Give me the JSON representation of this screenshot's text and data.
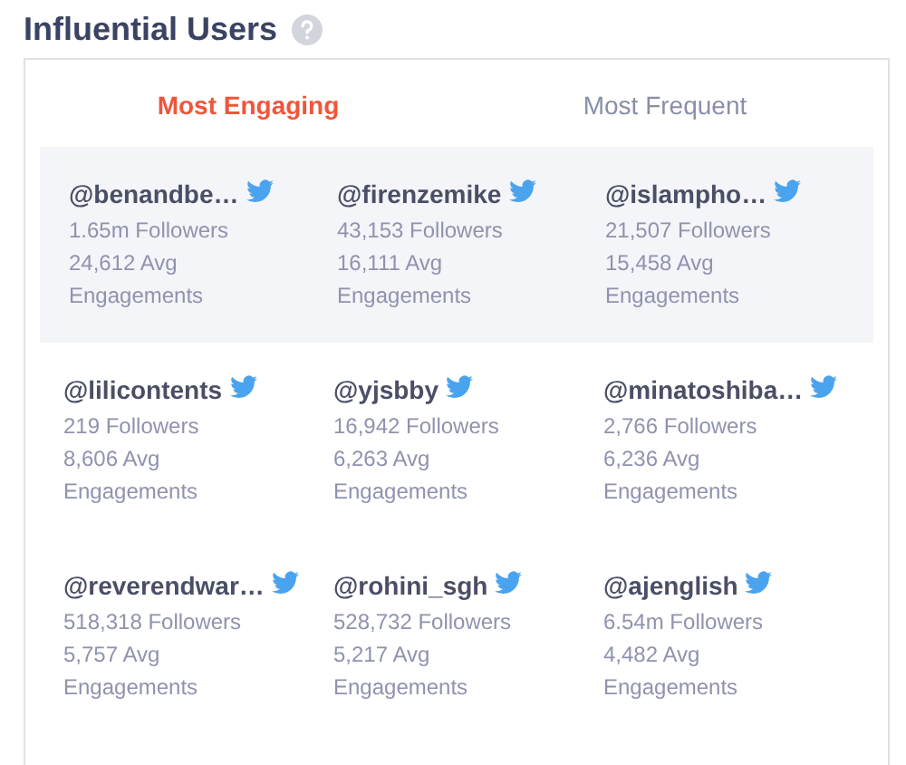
{
  "title": "Influential Users",
  "tabs": [
    {
      "label": "Most Engaging",
      "selected": true
    },
    {
      "label": "Most Frequent",
      "selected": false
    }
  ],
  "rows": [
    {
      "selected": true,
      "users": [
        {
          "handle": "@benandbe…",
          "followers": "1.65m Followers",
          "avg": "24,612 Avg",
          "engagements": "Engagements"
        },
        {
          "handle": "@firenzemike",
          "followers": "43,153 Followers",
          "avg": "16,111 Avg",
          "engagements": "Engagements"
        },
        {
          "handle": "@islampho…",
          "followers": "21,507 Followers",
          "avg": "15,458 Avg",
          "engagements": "Engagements"
        }
      ]
    },
    {
      "selected": false,
      "users": [
        {
          "handle": "@lilicontents",
          "followers": "219 Followers",
          "avg": "8,606 Avg",
          "engagements": "Engagements"
        },
        {
          "handle": "@yjsbby",
          "followers": "16,942 Followers",
          "avg": "6,263 Avg",
          "engagements": "Engagements"
        },
        {
          "handle": "@minatoshiba…",
          "followers": "2,766 Followers",
          "avg": "6,236 Avg",
          "engagements": "Engagements"
        }
      ]
    },
    {
      "selected": false,
      "users": [
        {
          "handle": "@reverendwar…",
          "followers": "518,318 Followers",
          "avg": "5,757 Avg",
          "engagements": "Engagements"
        },
        {
          "handle": "@rohini_sgh",
          "followers": "528,732 Followers",
          "avg": "5,217 Avg",
          "engagements": "Engagements"
        },
        {
          "handle": "@ajenglish",
          "followers": "6.54m Followers",
          "avg": "4,482 Avg",
          "engagements": "Engagements"
        }
      ]
    }
  ]
}
